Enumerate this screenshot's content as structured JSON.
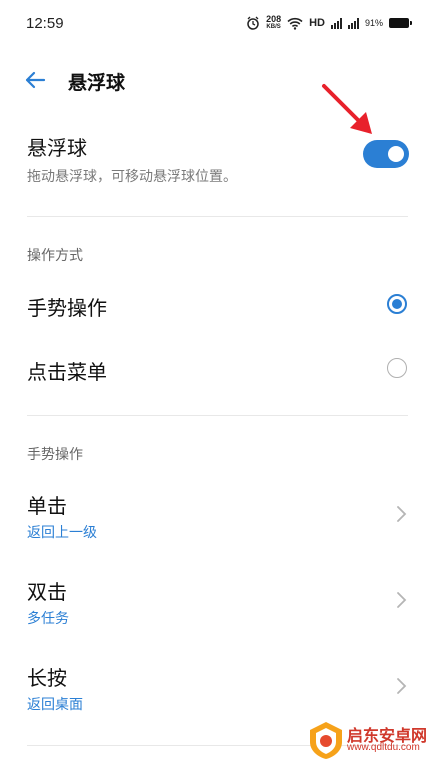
{
  "status_bar": {
    "time": "12:59",
    "net_speed": "208",
    "net_unit": "KB/S",
    "hd": "HD",
    "battery": "91%"
  },
  "header": {
    "title": "悬浮球"
  },
  "floating_ball": {
    "title": "悬浮球",
    "subtitle": "拖动悬浮球，可移动悬浮球位置。",
    "enabled": true
  },
  "operation_mode": {
    "label": "操作方式",
    "options": [
      {
        "label": "手势操作",
        "selected": true
      },
      {
        "label": "点击菜单",
        "selected": false
      }
    ]
  },
  "gestures": {
    "label": "手势操作",
    "items": [
      {
        "title": "单击",
        "value": "返回上一级"
      },
      {
        "title": "双击",
        "value": "多任务"
      },
      {
        "title": "长按",
        "value": "返回桌面"
      }
    ]
  },
  "watermark": {
    "name": "启东安卓网",
    "url": "www.qdltdu.com"
  },
  "colors": {
    "accent": "#2b7fd4",
    "annotation": "#e8212b"
  }
}
